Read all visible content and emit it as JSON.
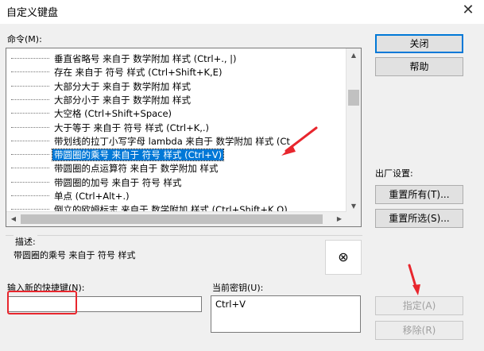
{
  "window": {
    "title": "自定义键盘",
    "close_glyph": "✕"
  },
  "commands": {
    "label": "命令(M):",
    "items": [
      "垂直省略号 来自于 数学附加 样式 (Ctrl+., |)",
      "存在 来自于 符号 样式 (Ctrl+Shift+K,E)",
      "大部分大于 来自于 数学附加 样式",
      "大部分小于 来自于 数学附加 样式",
      "大空格 (Ctrl+Shift+Space)",
      "大于等于 来自于 符号 样式 (Ctrl+K,.)",
      "带划线的拉丁小写字母 lambda 来自于 数学附加 样式 (Ct",
      "带圆圈的乘号 来自于 符号 样式 (Ctrl+V)",
      "带圆圈的点运算符 来自于 数学附加 样式",
      "带圆圈的加号 来自于 符号 样式",
      "单点 (Ctrl+Alt+.)",
      "倒立的欧姆标志 来自于 数学附加 样式 (Ctrl+Shift+K,O)"
    ],
    "selected_index": 7
  },
  "buttons": {
    "close": "关闭",
    "help": "帮助",
    "reset_all": "重置所有(T)...",
    "reset_selection": "重置所选(S)...",
    "assign": "指定(A)",
    "remove": "移除(R)"
  },
  "factory": {
    "label": "出厂设置:"
  },
  "description": {
    "label": "描述:",
    "text": "带圆圈的乘号 来自于 符号 样式",
    "preview_symbol": "⊗"
  },
  "new_shortcut": {
    "label": "输入新的快捷键(N):",
    "value": ""
  },
  "current_keys": {
    "label": "当前密钥(U):",
    "items": [
      "Ctrl+V"
    ]
  }
}
